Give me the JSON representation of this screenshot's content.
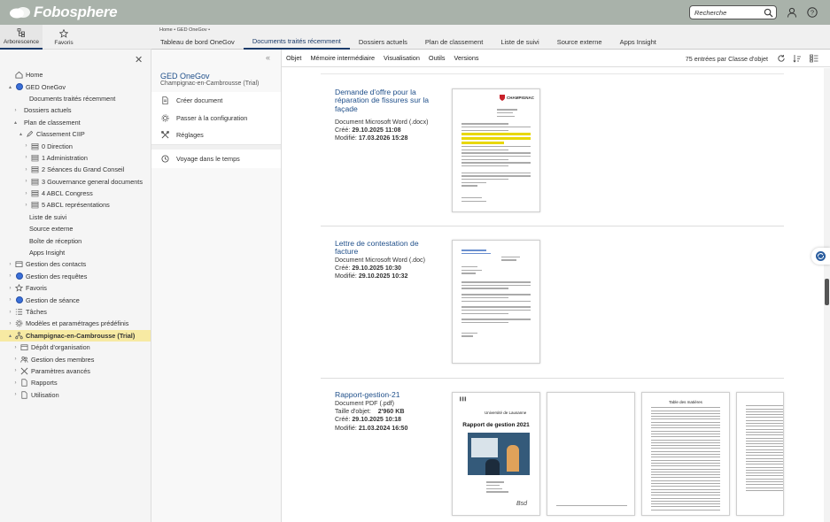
{
  "app": {
    "logo": "Fobosphere",
    "search_placeholder": "Recherche"
  },
  "left_tabs": [
    {
      "label": "Arborescence",
      "icon": "tree-icon"
    },
    {
      "label": "Favoris",
      "icon": "star-icon"
    }
  ],
  "tree": [
    {
      "label": "Home",
      "indent": 0,
      "icon": "home-icon",
      "toggle": ""
    },
    {
      "label": "GED OneGov",
      "indent": 0,
      "icon": "globe-icon",
      "toggle": "▴"
    },
    {
      "label": "Documents traités récemment",
      "indent": 2,
      "icon": "",
      "toggle": ""
    },
    {
      "label": "Dossiers actuels",
      "indent": 1,
      "icon": "",
      "toggle": "›"
    },
    {
      "label": "Plan de classement",
      "indent": 1,
      "icon": "",
      "toggle": "▴"
    },
    {
      "label": "Classement CIIP",
      "indent": 2,
      "icon": "pen-icon",
      "toggle": "▴"
    },
    {
      "label": "0 Direction",
      "indent": 3,
      "icon": "stack-icon",
      "toggle": "›"
    },
    {
      "label": "1 Administration",
      "indent": 3,
      "icon": "stack-icon",
      "toggle": "›"
    },
    {
      "label": "2 Séances du Grand Conseil",
      "indent": 3,
      "icon": "stack-icon",
      "toggle": "›"
    },
    {
      "label": "3 Gouvernance general documents",
      "indent": 3,
      "icon": "stack-icon",
      "toggle": "›"
    },
    {
      "label": "4 ABCL Congress",
      "indent": 3,
      "icon": "stack-icon",
      "toggle": "›"
    },
    {
      "label": "5 ABCL représentations",
      "indent": 3,
      "icon": "stack-icon",
      "toggle": "›"
    },
    {
      "label": "Liste de suivi",
      "indent": 2,
      "icon": "",
      "toggle": ""
    },
    {
      "label": "Source externe",
      "indent": 2,
      "icon": "",
      "toggle": ""
    },
    {
      "label": "Boîte de réception",
      "indent": 2,
      "icon": "",
      "toggle": ""
    },
    {
      "label": "Apps Insight",
      "indent": 2,
      "icon": "",
      "toggle": ""
    },
    {
      "label": "Gestion des contacts",
      "indent": 0,
      "icon": "box-icon",
      "toggle": "›"
    },
    {
      "label": "Gestion des requêtes",
      "indent": 0,
      "icon": "globe-icon",
      "toggle": "›"
    },
    {
      "label": "Favoris",
      "indent": 0,
      "icon": "star-icon",
      "toggle": "›"
    },
    {
      "label": "Gestion de séance",
      "indent": 0,
      "icon": "globe-icon",
      "toggle": "›"
    },
    {
      "label": "Tâches",
      "indent": 0,
      "icon": "list-icon",
      "toggle": "›"
    },
    {
      "label": "Modèles et paramétrages prédéfinis",
      "indent": 0,
      "icon": "gear-icon",
      "toggle": "›"
    },
    {
      "label": "Champignac-en-Cambrousse (Trial)",
      "indent": 0,
      "icon": "org-icon",
      "toggle": "▴",
      "selected": true
    },
    {
      "label": "Dépôt d'organisation",
      "indent": 1,
      "icon": "box-icon",
      "toggle": "›"
    },
    {
      "label": "Gestion des membres",
      "indent": 1,
      "icon": "users-icon",
      "toggle": "›"
    },
    {
      "label": "Paramètres avancés",
      "indent": 1,
      "icon": "tools-icon",
      "toggle": "›"
    },
    {
      "label": "Rapports",
      "indent": 1,
      "icon": "doc-icon",
      "toggle": "›"
    },
    {
      "label": "Utilisation",
      "indent": 1,
      "icon": "doc-icon",
      "toggle": "›"
    }
  ],
  "breadcrumb": "Home  •  GED OneGov  •",
  "main_tabs": [
    "Tableau de bord OneGov",
    "Documents traités récemment",
    "Dossiers actuels",
    "Plan de classement",
    "Liste de suivi",
    "Source externe",
    "Apps Insight"
  ],
  "active_tab": 1,
  "nav": {
    "title": "GED OneGov",
    "subtitle": "Champignac-en-Cambrousse (Trial)",
    "actions": [
      {
        "label": "Créer document",
        "icon": "new-document-icon"
      },
      {
        "label": "Passer à la configuration",
        "icon": "gear-icon"
      },
      {
        "label": "Réglages",
        "icon": "tools-icon"
      }
    ],
    "extra": {
      "label": "Voyage dans le temps",
      "icon": "history-icon"
    }
  },
  "toolbar": {
    "items": [
      "Objet",
      "Mémoire intermédiaire",
      "Visualisation",
      "Outils",
      "Versions"
    ],
    "count_label": "75 entrées par Classe d'objet"
  },
  "documents": [
    {
      "title": "Demande d'offre pour la réparation de fissures sur la façade",
      "type": "Document Microsoft Word (.docx)",
      "created_label": "Créé:",
      "created": "29.10.2025 11:08",
      "modified_label": "Modifié:",
      "modified": "17.03.2026 15:28",
      "thumb_header": "CHAMPIGNAC"
    },
    {
      "title": "Lettre de contestation de facture",
      "type": "Document Microsoft Word (.doc)",
      "created_label": "Créé:",
      "created": "29.10.2025 10:30",
      "modified_label": "Modifié:",
      "modified": "29.10.2025 10:32"
    },
    {
      "title": "Rapport-gestion-21",
      "type": "Document PDF (.pdf)",
      "size_label": "Taille d'objet:",
      "size": "2'960 KB",
      "created_label": "Créé:",
      "created": "29.10.2025 10:18",
      "modified_label": "Modifié:",
      "modified": "21.03.2024 16:50",
      "thumb_univ": "Université de Lausanne",
      "thumb_title": "Rapport de gestion 2021",
      "thumb_toc": "Table des matières"
    }
  ]
}
